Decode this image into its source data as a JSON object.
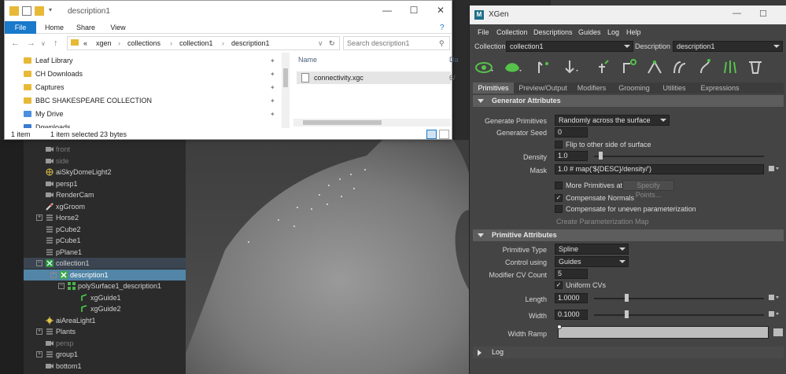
{
  "explorer": {
    "title": "description1",
    "ribbon_tabs": [
      "File",
      "Home",
      "Share",
      "View"
    ],
    "path_prefix": "«",
    "breadcrumb": [
      "xgen",
      "collections",
      "collection1",
      "description1"
    ],
    "search_placeholder": "Search description1",
    "nav_items": [
      "Leaf Library",
      "CH Downloads",
      "Captures",
      "BBC SHAKESPEARE COLLECTION",
      "My Drive",
      "Downloads"
    ],
    "column_name": "Name",
    "column_date": "Da",
    "files": [
      {
        "name": "connectivity.xgc",
        "date": "6/"
      }
    ],
    "status_items": "1 item",
    "status_selected": "1 item selected  23 bytes"
  },
  "outliner": {
    "items": [
      {
        "label": "front",
        "icon": "camera-icon",
        "dim": true
      },
      {
        "label": "side",
        "icon": "camera-icon",
        "dim": true
      },
      {
        "label": "aiSkyDomeLight2",
        "icon": "skydome-light-icon"
      },
      {
        "label": "persp1",
        "icon": "camera-icon"
      },
      {
        "label": "RenderCam",
        "icon": "camera-icon"
      },
      {
        "label": "xgGroom",
        "icon": "groom-icon"
      },
      {
        "label": "Horse2",
        "icon": "transform-icon",
        "expander": "+"
      },
      {
        "label": "pCube2",
        "icon": "transform-icon"
      },
      {
        "label": "pCube1",
        "icon": "transform-icon"
      },
      {
        "label": "pPlane1",
        "icon": "transform-icon"
      },
      {
        "label": "collection1",
        "icon": "xgen-collection-icon",
        "expander": "−",
        "highlight": true
      },
      {
        "label": "description1",
        "icon": "xgen-description-icon",
        "expander": "−",
        "selected": true
      },
      {
        "label": "polySurface1_description1",
        "icon": "mesh-icon",
        "expander": "−"
      },
      {
        "label": "xgGuide1",
        "icon": "guide-icon"
      },
      {
        "label": "xgGuide2",
        "icon": "guide-icon"
      },
      {
        "label": "aiAreaLight1",
        "icon": "area-light-icon"
      },
      {
        "label": "Plants",
        "icon": "transform-icon",
        "expander": "+"
      },
      {
        "label": "persp",
        "icon": "camera-icon",
        "dim": true
      },
      {
        "label": "group1",
        "icon": "transform-icon",
        "expander": "+"
      },
      {
        "label": "bottom1",
        "icon": "camera-icon"
      }
    ]
  },
  "xgen": {
    "title": "XGen",
    "menu": [
      "File",
      "Collection",
      "Descriptions",
      "Guides",
      "Log",
      "Help"
    ],
    "collection_label": "Collection",
    "collection_value": "collection1",
    "description_label": "Description",
    "description_value": "description1",
    "tabs": [
      "Primitives",
      "Preview/Output",
      "Modifiers",
      "Grooming",
      "Utilities",
      "Expressions"
    ],
    "generator": {
      "header": "Generator Attributes",
      "generate_label": "Generate Primitives",
      "generate_value": "Randomly across the surface",
      "seed_label": "Generator Seed",
      "seed_value": "0",
      "flip_label": "Flip to other side of surface",
      "density_label": "Density",
      "density_value": "1.0",
      "density_slider": 0.03,
      "mask_label": "Mask",
      "mask_value": "1.0 # map('${DESC}/density/')",
      "more_label": "More Primitives at",
      "specify_points": "Specify Points...",
      "comp_normals": "Compensate Normals",
      "comp_uneven": "Compensate for uneven parameterization",
      "create_map": "Create Parameterization Map"
    },
    "primitive": {
      "header": "Primitive Attributes",
      "type_label": "Primitive Type",
      "type_value": "Spline",
      "control_label": "Control using",
      "control_value": "Guides",
      "cv_label": "Modifier CV Count",
      "cv_value": "5",
      "uniform_label": "Uniform CVs",
      "length_label": "Length",
      "length_value": "1.0000",
      "width_label": "Width",
      "width_value": "0.1000",
      "ramp_label": "Width Ramp"
    },
    "log_label": "Log"
  }
}
